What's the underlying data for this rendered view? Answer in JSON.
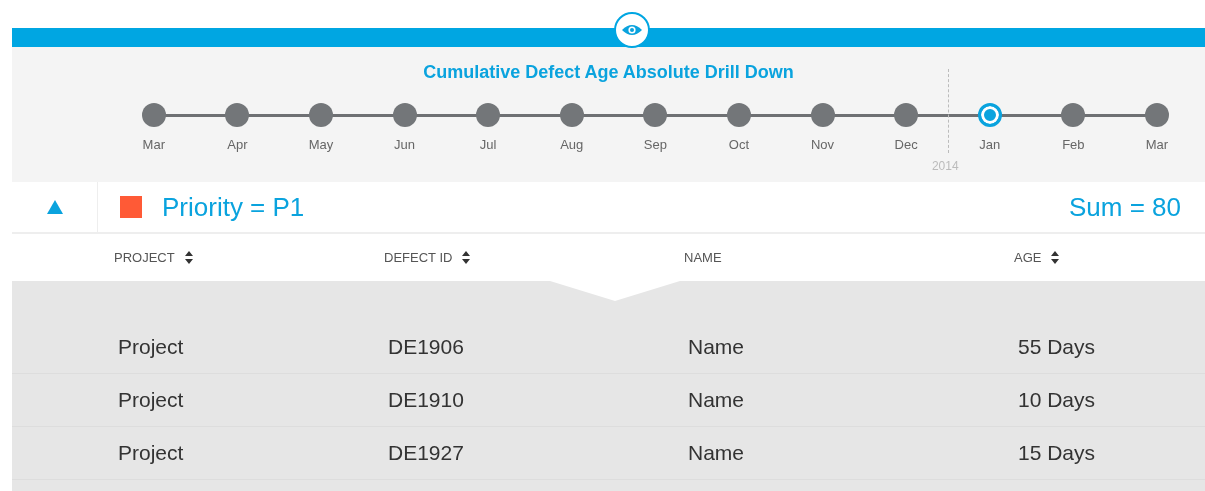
{
  "title": "Cumulative Defect Age Absolute Drill Down",
  "timeline": [
    {
      "label": "Mar",
      "selected": false
    },
    {
      "label": "Apr",
      "selected": false
    },
    {
      "label": "May",
      "selected": false
    },
    {
      "label": "Jun",
      "selected": false
    },
    {
      "label": "Jul",
      "selected": false
    },
    {
      "label": "Aug",
      "selected": false
    },
    {
      "label": "Sep",
      "selected": false
    },
    {
      "label": "Oct",
      "selected": false
    },
    {
      "label": "Nov",
      "selected": false
    },
    {
      "label": "Dec",
      "selected": false
    },
    {
      "label": "Jan",
      "selected": true,
      "year": "2014"
    },
    {
      "label": "Feb",
      "selected": false
    },
    {
      "label": "Mar",
      "selected": false
    }
  ],
  "group": {
    "expanded": true,
    "color": "#ff5a36",
    "label": "Priority = P1",
    "sum": "Sum = 80"
  },
  "table": {
    "columns": [
      {
        "label": "PROJECT",
        "sortable": true
      },
      {
        "label": "DEFECT ID",
        "sortable": true
      },
      {
        "label": "NAME",
        "sortable": false
      },
      {
        "label": "AGE",
        "sortable": true
      }
    ],
    "rows": [
      [
        "Project",
        "DE1906",
        "Name",
        "55 Days"
      ],
      [
        "Project",
        "DE1910",
        "Name",
        "10 Days"
      ],
      [
        "Project",
        "DE1927",
        "Name",
        "15 Days"
      ]
    ]
  }
}
